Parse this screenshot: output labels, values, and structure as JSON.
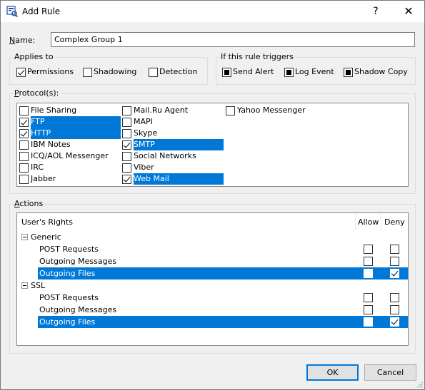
{
  "window": {
    "title": "Add Rule",
    "help_glyph": "?",
    "close_glyph": "✕"
  },
  "name": {
    "label": "Name:",
    "value": "Complex Group 1"
  },
  "applies_to": {
    "label": "Applies to",
    "items": [
      {
        "label": "Permissions",
        "checked": true
      },
      {
        "label": "Shadowing",
        "checked": false
      },
      {
        "label": "Detection",
        "checked": false
      }
    ]
  },
  "triggers": {
    "label": "If this rule triggers",
    "items": [
      {
        "label": "Send Alert",
        "checked": true
      },
      {
        "label": "Log Event",
        "checked": true
      },
      {
        "label": "Shadow Copy",
        "checked": true
      }
    ]
  },
  "protocols": {
    "label": "Protocol(s):",
    "items": [
      {
        "label": "File Sharing",
        "checked": false,
        "selected": false
      },
      {
        "label": "FTP",
        "checked": true,
        "selected": true
      },
      {
        "label": "HTTP",
        "checked": true,
        "selected": true
      },
      {
        "label": "IBM Notes",
        "checked": false,
        "selected": false
      },
      {
        "label": "ICQ/AOL Messenger",
        "checked": false,
        "selected": false
      },
      {
        "label": "IRC",
        "checked": false,
        "selected": false
      },
      {
        "label": "Jabber",
        "checked": false,
        "selected": false
      },
      {
        "label": "Mail.Ru Agent",
        "checked": false,
        "selected": false
      },
      {
        "label": "MAPI",
        "checked": false,
        "selected": false
      },
      {
        "label": "Skype",
        "checked": false,
        "selected": false
      },
      {
        "label": "SMTP",
        "checked": true,
        "selected": true
      },
      {
        "label": "Social Networks",
        "checked": false,
        "selected": false
      },
      {
        "label": "Viber",
        "checked": false,
        "selected": false
      },
      {
        "label": "Web Mail",
        "checked": true,
        "selected": true
      },
      {
        "label": "Yahoo Messenger",
        "checked": false,
        "selected": false
      }
    ]
  },
  "actions": {
    "label": "Actions",
    "columns": {
      "rights": "User's Rights",
      "allow": "Allow",
      "deny": "Deny"
    },
    "groups": [
      {
        "name": "Generic",
        "rows": [
          {
            "label": "POST Requests",
            "allow": false,
            "deny": false,
            "selected": false
          },
          {
            "label": "Outgoing Messages",
            "allow": false,
            "deny": false,
            "selected": false
          },
          {
            "label": "Outgoing Files",
            "allow": false,
            "deny": true,
            "selected": true
          }
        ]
      },
      {
        "name": "SSL",
        "rows": [
          {
            "label": "POST Requests",
            "allow": false,
            "deny": false,
            "selected": false
          },
          {
            "label": "Outgoing Messages",
            "allow": false,
            "deny": false,
            "selected": false
          },
          {
            "label": "Outgoing Files",
            "allow": false,
            "deny": true,
            "selected": true
          }
        ]
      }
    ]
  },
  "buttons": {
    "ok": "OK",
    "cancel": "Cancel"
  },
  "colors": {
    "selection": "#0078d7",
    "default_button_border": "#0078d7",
    "dialog_bg": "#f0f0f0"
  }
}
